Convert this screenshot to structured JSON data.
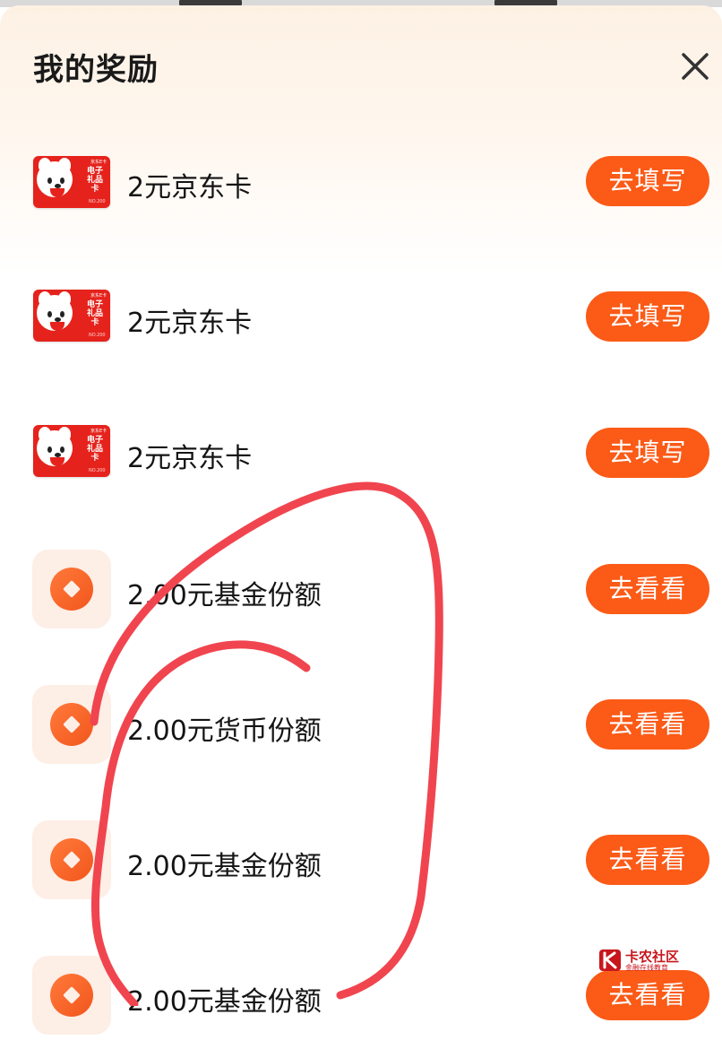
{
  "sheet": {
    "title": "我的奖励",
    "close_icon": "close-icon"
  },
  "rewards": [
    {
      "icon": "jd-gift-card-icon",
      "label": "2元京东卡",
      "action": "去填写"
    },
    {
      "icon": "jd-gift-card-icon",
      "label": "2元京东卡",
      "action": "去填写"
    },
    {
      "icon": "jd-gift-card-icon",
      "label": "2元京东卡",
      "action": "去填写"
    },
    {
      "icon": "coin-icon",
      "label": "2.00元基金份额",
      "action": "去看看"
    },
    {
      "icon": "coin-icon",
      "label": "2.00元货币份额",
      "action": "去看看"
    },
    {
      "icon": "coin-icon",
      "label": "2.00元基金份额",
      "action": "去看看"
    },
    {
      "icon": "coin-icon",
      "label": "2.00元基金份额",
      "action": "去看看"
    }
  ],
  "gift_card_text": {
    "brand": "京东E卡",
    "name": "电子礼品卡",
    "small": "NO.200"
  },
  "colors": {
    "accent": "#fb5a17",
    "card_red": "#e5231c",
    "coin_bg": "#fdeee6",
    "scribble": "#f0454f"
  },
  "watermark": {
    "name": "卡农社区",
    "sub": "金融在线教育"
  }
}
